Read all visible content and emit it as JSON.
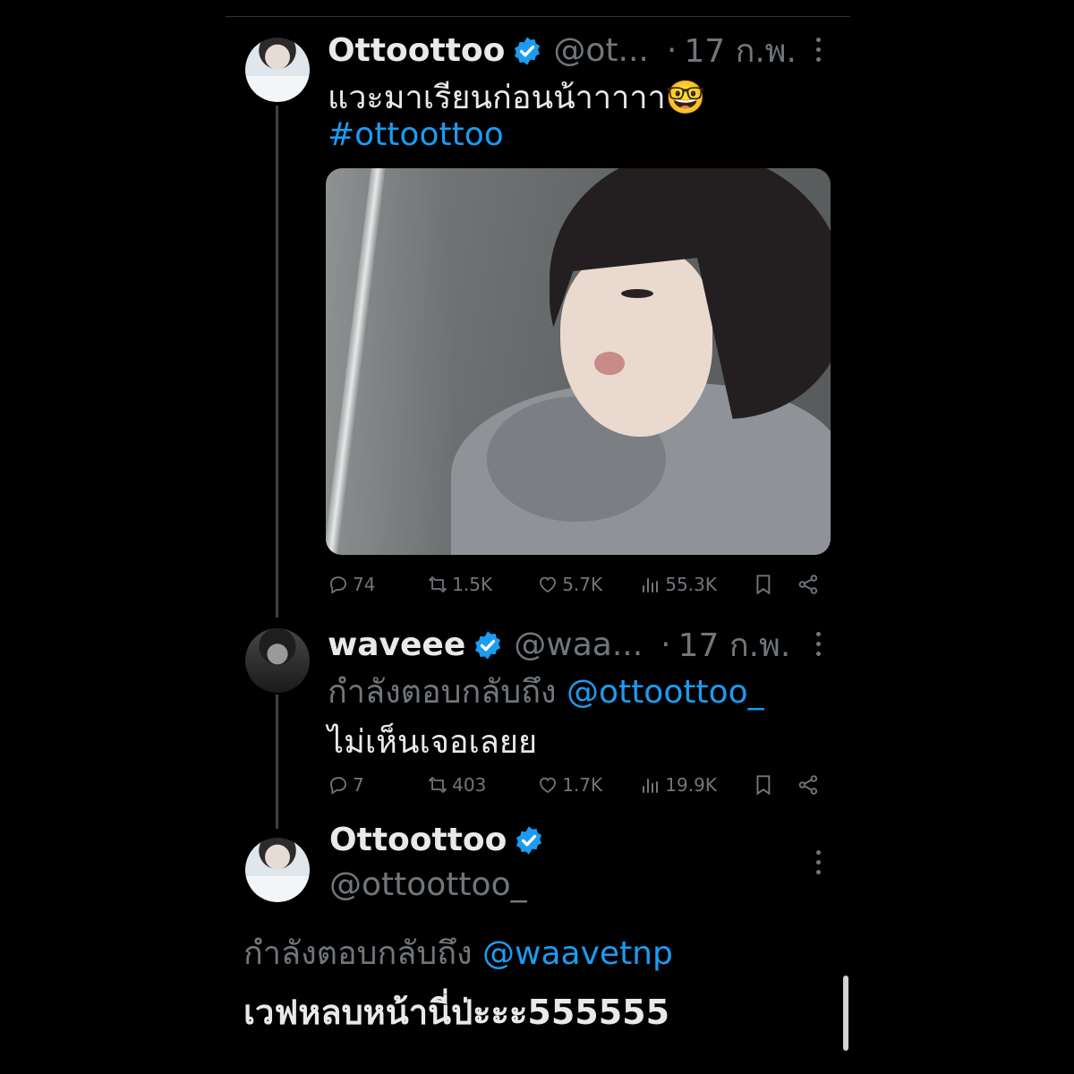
{
  "tweet1": {
    "name": "Ottoottoo",
    "handle": "@ot...",
    "separator": "·",
    "date": "17 ก.พ.",
    "text": "แวะมาเรียนก่อนน้าาาาา🤓",
    "hashtag": "#ottoottoo",
    "stats": {
      "replies": "74",
      "retweets": "1.5K",
      "likes": "5.7K",
      "views": "55.3K"
    }
  },
  "tweet2": {
    "name": "waveee",
    "handle": "@waa...",
    "separator": "·",
    "date": "17 ก.พ.",
    "reply_prefix": "กำลังตอบกลับถึง",
    "reply_to": "@ottoottoo_",
    "text": "ไม่เห็นเจอเลยย",
    "stats": {
      "replies": "7",
      "retweets": "403",
      "likes": "1.7K",
      "views": "19.9K"
    }
  },
  "tweet3": {
    "name": "Ottoottoo",
    "handle": "@ottoottoo_",
    "reply_prefix": "กำลังตอบกลับถึง",
    "reply_to": "@waavetnp",
    "text": "เวฟหลบหน้านี่ป่ะะะ555555"
  },
  "colors": {
    "background": "#000000",
    "text": "#e7e9ea",
    "muted": "#71767b",
    "link": "#1d9bf0"
  },
  "icons": [
    "verified-badge-icon",
    "more-icon",
    "reply-icon",
    "retweet-icon",
    "like-icon",
    "views-icon",
    "bookmark-icon",
    "share-icon"
  ]
}
